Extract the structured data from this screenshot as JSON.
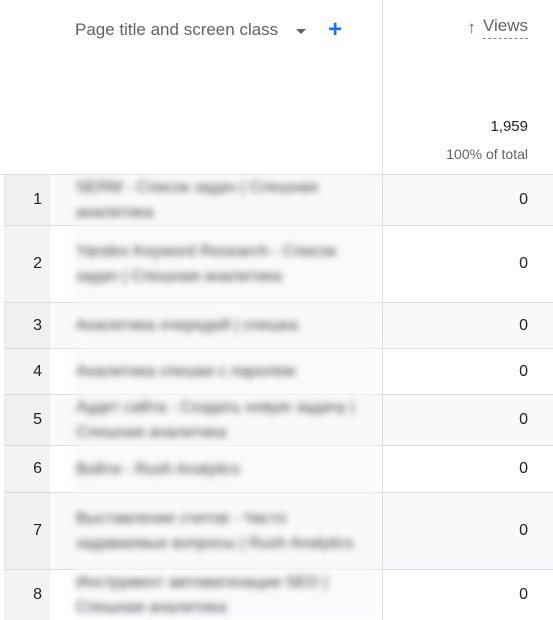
{
  "table": {
    "dimension_header": "Page title and screen class",
    "dimension_dropdown_icon": "caret-down-icon",
    "add_dimension_icon": "plus-icon",
    "add_dimension_symbol": "+",
    "metric_header": "Views",
    "sort_icon": "arrow-up-icon",
    "sort_symbol": "↑",
    "total_value": "1,959",
    "total_percent": "100% of total",
    "rows": [
      {
        "index": "1",
        "title": "SERM - Список задач | Спешная аналитика",
        "views": "0"
      },
      {
        "index": "2",
        "title": "Yandex Keyword Research - Список задач | Спешная аналитика",
        "views": "0"
      },
      {
        "index": "3",
        "title": "Аналитика очередей | спешка",
        "views": "0"
      },
      {
        "index": "4",
        "title": "Аналитика спешки с паролем",
        "views": "0"
      },
      {
        "index": "5",
        "title": "Аудит сайта - Создать новую задачу | Спешная аналитика",
        "views": "0"
      },
      {
        "index": "6",
        "title": "Войти - Rush Analytics",
        "views": "0"
      },
      {
        "index": "7",
        "title": "Выставление счетов - Часто задаваемые вопросы | Rush Analytics",
        "views": "0"
      },
      {
        "index": "8",
        "title": "Инструмент автоматизации SEO | Спешная аналитика",
        "views": "0"
      }
    ]
  },
  "colors": {
    "accent": "#1a73e8",
    "border": "#dadce0",
    "alt_row": "#f8f9fa",
    "muted_text": "#5f6368"
  }
}
